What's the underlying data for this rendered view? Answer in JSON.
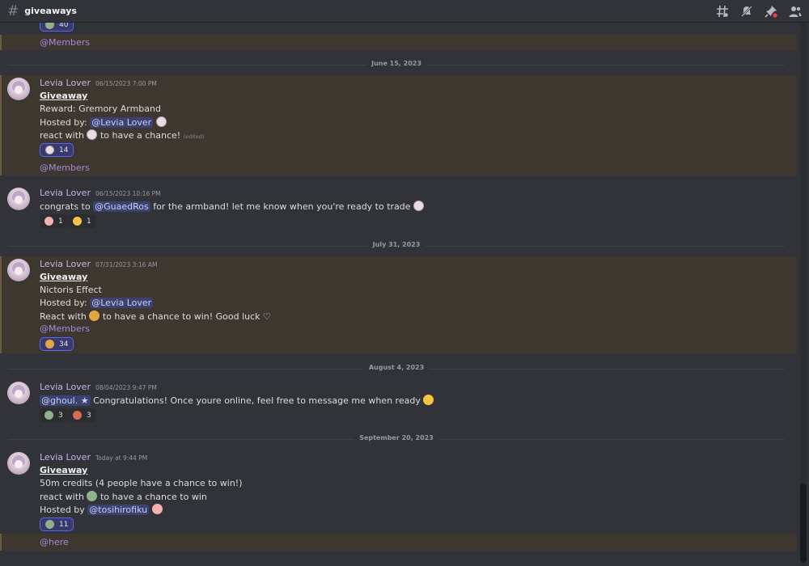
{
  "header": {
    "channel": "giveaways"
  },
  "icons": {
    "threads": "threads-icon",
    "mute": "bell-slash-icon",
    "pin": "pin-icon",
    "members": "members-icon"
  },
  "prev": {
    "reaction_count": "40",
    "role": "@Members"
  },
  "dates": [
    "June 15, 2023",
    "July 31, 2023",
    "August 4, 2023",
    "September 20, 2023"
  ],
  "m1": {
    "author": "Levia Lover",
    "time": "06/15/2023 7:00 PM",
    "title": "Giveaway",
    "reward": "Reward: Gremory Armband",
    "hosted_by": "Hosted by:",
    "host": "@Levia Lover",
    "react_a": "react with",
    "react_b": "to have a chance!",
    "edited": "(edited)",
    "reaction_count": "14",
    "role": "@Members"
  },
  "m2": {
    "author": "Levia Lover",
    "time": "06/15/2023 10:16 PM",
    "text_a": "congrats to",
    "mention": "@GuaedRos",
    "text_b": "for the armband! let me know when you're ready to trade",
    "r1": "1",
    "r2": "1"
  },
  "m3": {
    "author": "Levia Lover",
    "time": "07/31/2023 3:16 AM",
    "title": "Giveaway",
    "prize": "Nictoris Effect",
    "hosted_by": "Hosted by:",
    "host": "@Levia Lover",
    "react_a": "React with",
    "react_b": "to have a chance to win! Good luck ♡",
    "role": "@Members",
    "reaction_count": "34"
  },
  "m4": {
    "author": "Levia Lover",
    "time": "08/04/2023 9:47 PM",
    "mention": "@ghoul. ★",
    "text": "Congratulations! Once youre online, feel free to message me when ready",
    "r1": "3",
    "r2": "3"
  },
  "m5": {
    "author": "Levia Lover",
    "time": "Today at 9:44 PM",
    "title": "Giveaway",
    "prize": "50m credits (4 people have a chance to win!)",
    "react_a": "react with",
    "react_b": "to have a chance to win",
    "hosted_by": "Hosted by",
    "host": "@tosihirofiku",
    "reaction_count": "11",
    "role": "@here"
  }
}
